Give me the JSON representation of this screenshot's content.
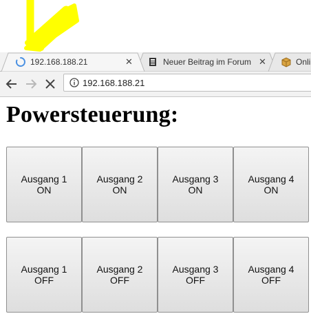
{
  "browser": {
    "tabs": [
      {
        "title": "192.168.188.21",
        "icon": "loading-spinner-icon",
        "active": true
      },
      {
        "title": "Neuer Beitrag im Forum",
        "icon": "forum-favicon-icon",
        "active": false
      },
      {
        "title": "Onli",
        "icon": "package-favicon-icon",
        "active": false
      }
    ],
    "close_glyph": "✕",
    "url": "192.168.188.21"
  },
  "page": {
    "title": "Powersteuerung:",
    "on_buttons": [
      {
        "line1": "Ausgang 1",
        "line2": "ON"
      },
      {
        "line1": "Ausgang 2",
        "line2": "ON"
      },
      {
        "line1": "Ausgang 3",
        "line2": "ON"
      },
      {
        "line1": "Ausgang 4",
        "line2": "ON"
      }
    ],
    "off_buttons": [
      {
        "line1": "Ausgang 1",
        "line2": "OFF"
      },
      {
        "line1": "Ausgang 2",
        "line2": "OFF"
      },
      {
        "line1": "Ausgang 3",
        "line2": "OFF"
      },
      {
        "line1": "Ausgang 4",
        "line2": "OFF"
      }
    ]
  },
  "colors": {
    "annotation_arrow": "#ffff00",
    "spinner": "#4a90e2"
  }
}
